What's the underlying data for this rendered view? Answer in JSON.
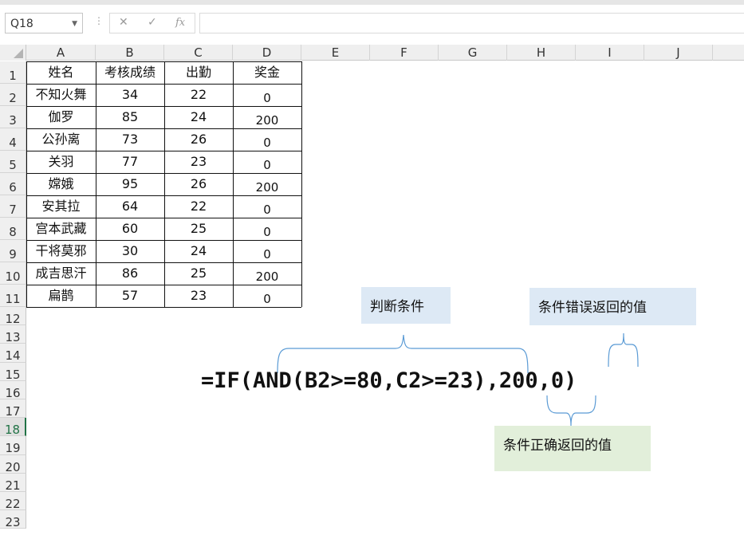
{
  "formula_bar": {
    "name_box": "Q18",
    "cancel_glyph": "✕",
    "enter_glyph": "✓",
    "fx_glyph": "fx",
    "formula_value": ""
  },
  "columns": [
    "A",
    "B",
    "C",
    "D",
    "E",
    "F",
    "G",
    "H",
    "I",
    "J"
  ],
  "rows": [
    "1",
    "2",
    "3",
    "4",
    "5",
    "6",
    "7",
    "8",
    "9",
    "10",
    "11",
    "12",
    "13",
    "14",
    "15",
    "16",
    "17",
    "18",
    "19",
    "20",
    "21",
    "22",
    "23"
  ],
  "selected_row": "18",
  "table": {
    "headers": [
      "姓名",
      "考核成绩",
      "出勤",
      "奖金"
    ],
    "rows": [
      [
        "不知火舞",
        "34",
        "22",
        "0"
      ],
      [
        "伽罗",
        "85",
        "24",
        "200"
      ],
      [
        "公孙离",
        "73",
        "26",
        "0"
      ],
      [
        "关羽",
        "77",
        "23",
        "0"
      ],
      [
        "嫦娥",
        "95",
        "26",
        "200"
      ],
      [
        "安其拉",
        "64",
        "22",
        "0"
      ],
      [
        "宫本武藏",
        "60",
        "25",
        "0"
      ],
      [
        "干将莫邪",
        "30",
        "24",
        "0"
      ],
      [
        "成吉思汗",
        "86",
        "25",
        "200"
      ],
      [
        "扁鹊",
        "57",
        "23",
        "0"
      ]
    ]
  },
  "annotation": {
    "formula": "=IF(AND(B2>=80,C2>=23),200,0)",
    "condition_label": "判断条件",
    "false_label": "条件错误返回的值",
    "true_label": "条件正确返回的值",
    "condition_color": "#dde9f5",
    "false_color": "#dde9f5",
    "true_color": "#e2efda",
    "brace_color": "#5b9bd5"
  }
}
